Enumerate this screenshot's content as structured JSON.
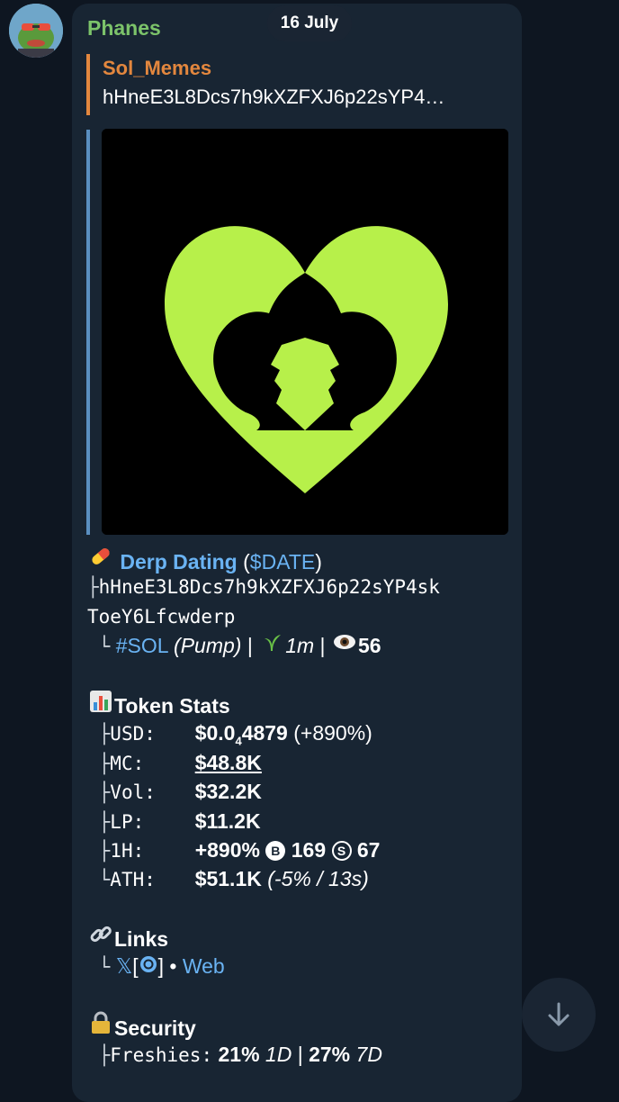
{
  "chat": {
    "date": "16 July",
    "sender": "Phanes",
    "reply": {
      "name": "Sol_Memes",
      "text": "hHneE3L8Dcs7h9kXZFXJ6p22sYP4…"
    }
  },
  "token": {
    "name": "Derp Dating",
    "symbol": "$DATE",
    "address_line1": "hHneE3L8Dcs7h9kXZFXJ6p22sYP4sk",
    "address_line2": "ToeY6Lfcwderp",
    "chain": "#SOL",
    "platform": "(Pump)",
    "age": "1m",
    "views": "56"
  },
  "stats": {
    "title": "Token Stats",
    "usd_label": "USD:",
    "usd_pre": "$0.0",
    "usd_sub": "4",
    "usd_post": "4879",
    "usd_change": "(+890%)",
    "mc_label": "MC:",
    "mc": "$48.8K",
    "vol_label": "Vol:",
    "vol": "$32.2K",
    "lp_label": "LP:",
    "lp": "$11.2K",
    "h1_label": "1H:",
    "h1": "+890%",
    "buy_badge": "B",
    "buys": "169",
    "sell_badge": "S",
    "sells": "67",
    "ath_label": "ATH:",
    "ath": "$51.1K",
    "ath_detail": "(-5% / 13s)"
  },
  "links": {
    "title": "Links",
    "x": "𝕏",
    "bracket_open": "[",
    "bracket_close": "]",
    "sep": "•",
    "web": "Web"
  },
  "security": {
    "title": "Security",
    "freshies_label": "Freshies:",
    "freshies_1d": "21%",
    "freshies_1d_unit": "1D",
    "freshies_7d": "27%",
    "freshies_7d_unit": "7D"
  },
  "icons": {
    "pill": "pill-icon",
    "seedling": "seedling-icon",
    "eye": "eye-icon",
    "chart": "bar-chart-icon",
    "link": "link-icon",
    "lock": "lock-icon",
    "scroll_down": "arrow-down-icon"
  },
  "colors": {
    "background": "#0e1621",
    "bubble": "#182533",
    "sender": "#7cc36a",
    "reply_accent": "#e3873e",
    "link": "#6ab3f3",
    "logo_green": "#b7f04a"
  }
}
